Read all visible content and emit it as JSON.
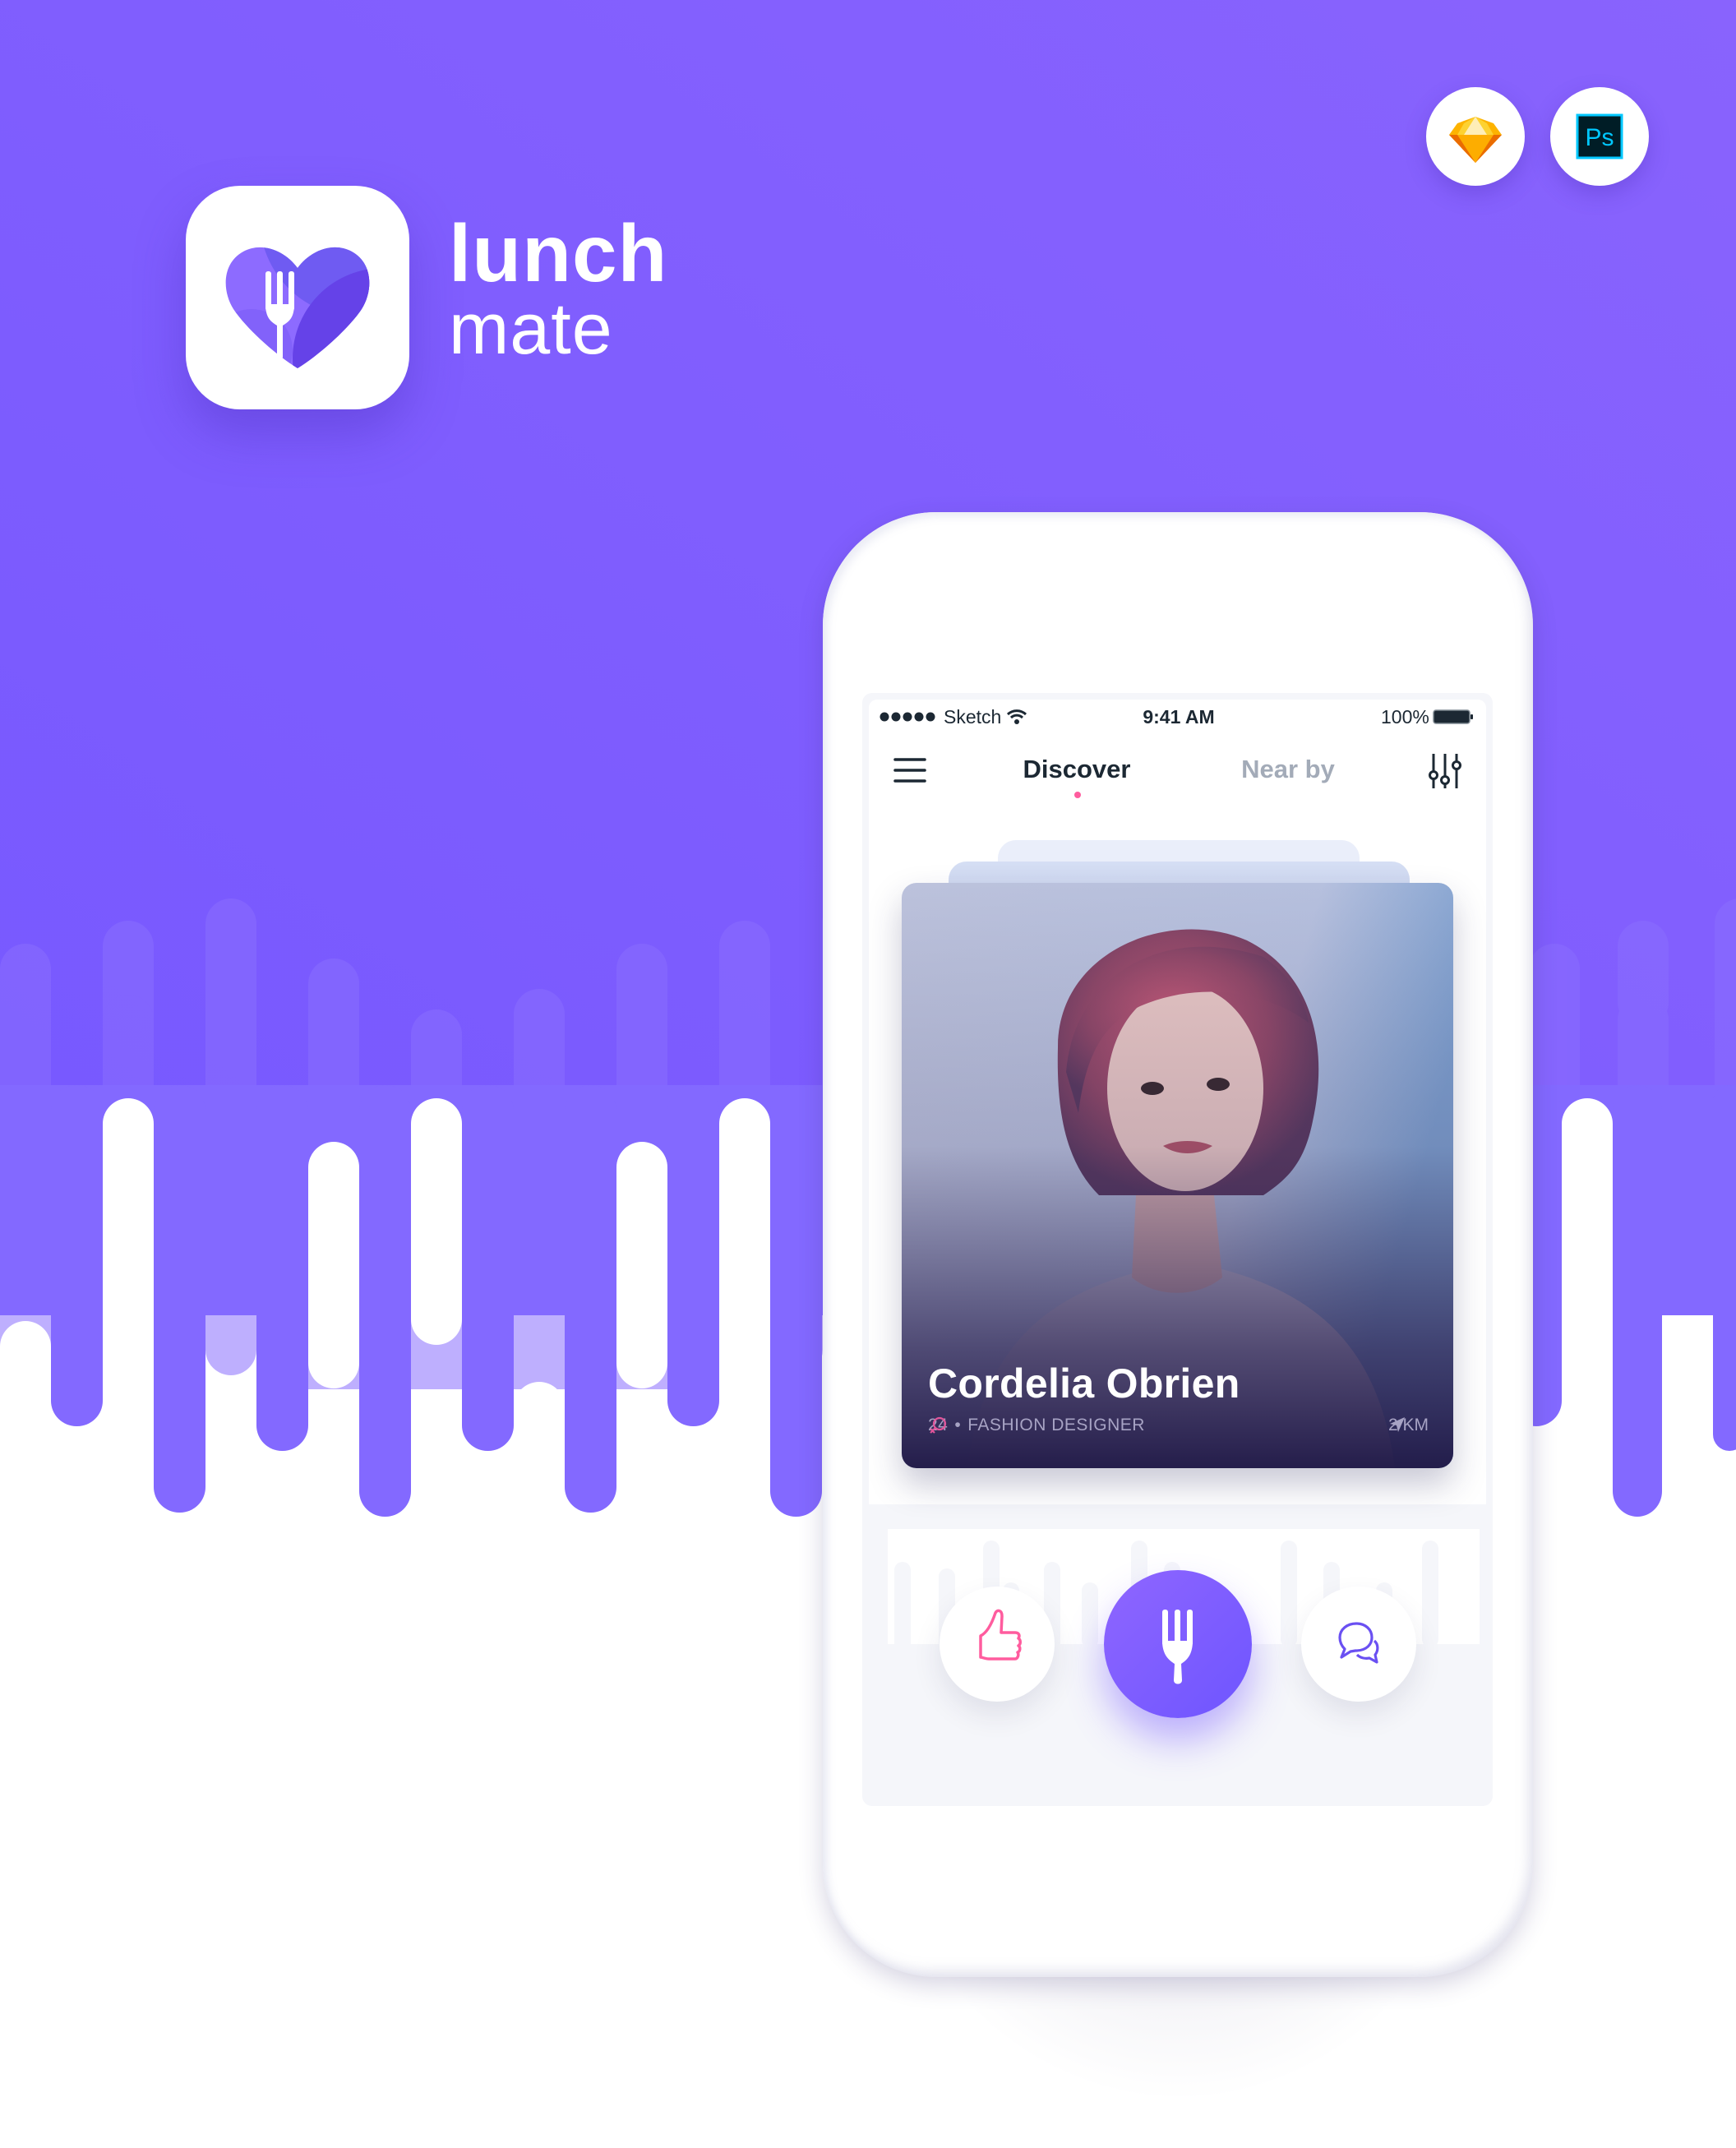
{
  "brand": {
    "name_line1": "lunch",
    "name_line2": "mate",
    "icon": "heart-fork-icon"
  },
  "tools": [
    {
      "name": "Sketch",
      "icon": "sketch-diamond-icon"
    },
    {
      "name": "Photoshop",
      "icon": "photoshop-icon",
      "label": "Ps"
    }
  ],
  "colors": {
    "background": "#7f5fff",
    "accent": "#7658ff",
    "pink": "#ff5c9e",
    "text_dark": "#1c2833",
    "text_muted": "#a3abb8"
  },
  "status_bar": {
    "carrier": "Sketch",
    "time": "9:41 AM",
    "battery": "100%",
    "signal_icon": "signal-dots-icon",
    "wifi_icon": "wifi-icon",
    "battery_icon": "battery-icon"
  },
  "nav": {
    "menu_icon": "hamburger-menu-icon",
    "tabs": [
      {
        "label": "Discover",
        "active": true
      },
      {
        "label": "Near by",
        "active": false
      }
    ],
    "filter_icon": "sliders-icon"
  },
  "profile": {
    "name": "Cordelia Obrien",
    "gender_icon": "female-icon",
    "age": "24",
    "separator": "•",
    "occupation": "FASHION DESIGNER",
    "distance": "2 KM",
    "distance_icon": "location-arrow-icon"
  },
  "actions": [
    {
      "name": "like",
      "icon": "thumbs-up-icon"
    },
    {
      "name": "lunch",
      "icon": "fork-icon"
    },
    {
      "name": "chat",
      "icon": "chat-bubbles-icon"
    }
  ]
}
